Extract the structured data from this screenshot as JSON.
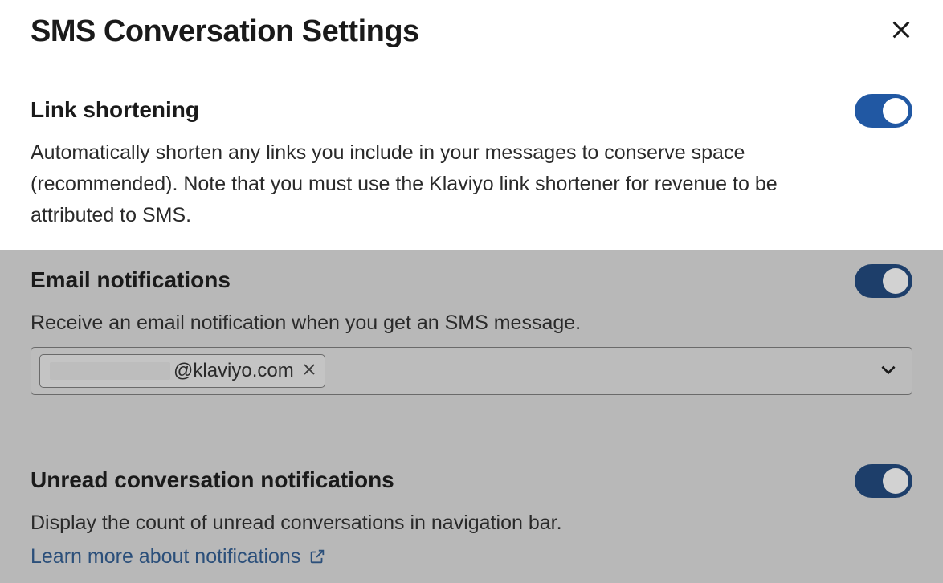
{
  "header": {
    "title": "SMS Conversation Settings"
  },
  "sections": {
    "link_shortening": {
      "title": "Link shortening",
      "desc": "Automatically shorten any links you include in your messages to conserve space (recommended). Note that you must use the Klaviyo link shortener for revenue to be attributed to SMS.",
      "enabled": true
    },
    "email_notifications": {
      "title": "Email notifications",
      "desc": "Receive an email notification when you get an SMS message.",
      "enabled": true,
      "email_suffix": "@klaviyo.com"
    },
    "unread": {
      "title": "Unread conversation notifications",
      "desc": "Display the count of unread conversations in navigation bar.",
      "enabled": true,
      "link_text": "Learn more about notifications"
    }
  }
}
